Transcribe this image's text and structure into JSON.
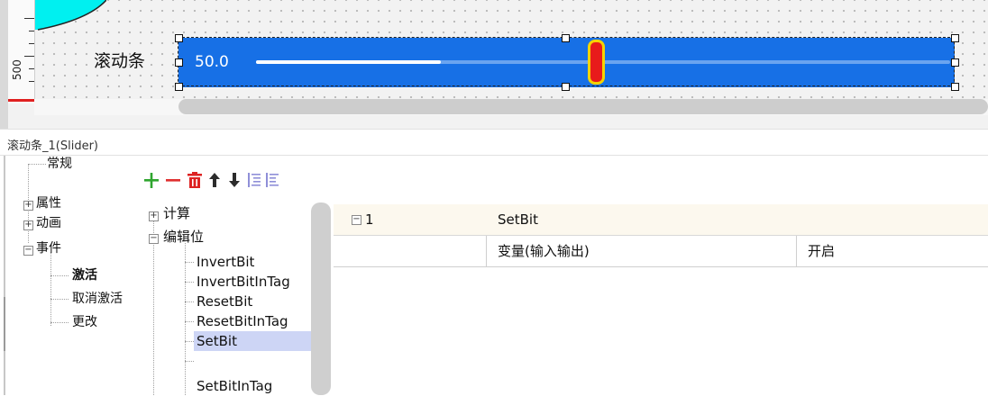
{
  "canvas": {
    "ruler_label": "500",
    "slider": {
      "label": "滚动条",
      "value_text": "50.0",
      "position": 0.5,
      "colors": {
        "background": "#1770e6",
        "thumb": "#e81b1b",
        "thumb_border": "#f5d300"
      }
    }
  },
  "object_header": {
    "title": "滚动条_1(Slider)"
  },
  "categories": [
    {
      "label": "常规",
      "expander": ""
    },
    {
      "label": "属性",
      "expander": "+"
    },
    {
      "label": "动画",
      "expander": "+"
    },
    {
      "label": "事件",
      "expander": "−"
    },
    {
      "label": "激活",
      "expander": "",
      "selected": true
    },
    {
      "label": "取消激活",
      "expander": ""
    },
    {
      "label": "更改",
      "expander": ""
    }
  ],
  "toolbar": {
    "icons": [
      "add-icon",
      "remove-icon",
      "delete-icon",
      "move-up-icon",
      "move-down-icon",
      "indent-icon",
      "outdent-icon"
    ]
  },
  "functions": {
    "groups": [
      {
        "label": "计算",
        "expander": "+"
      },
      {
        "label": "编辑位",
        "expander": "−"
      }
    ],
    "items": [
      "InvertBit",
      "InvertBitInTag",
      "ResetBit",
      "ResetBitInTag",
      "SetBit",
      "SetBitInTag"
    ],
    "selected_item": "SetBit"
  },
  "grid": {
    "row1": {
      "expander": "−",
      "index": "1",
      "function": "SetBit"
    },
    "row2": {
      "param": "变量(输入输出)",
      "value": "开启"
    }
  }
}
